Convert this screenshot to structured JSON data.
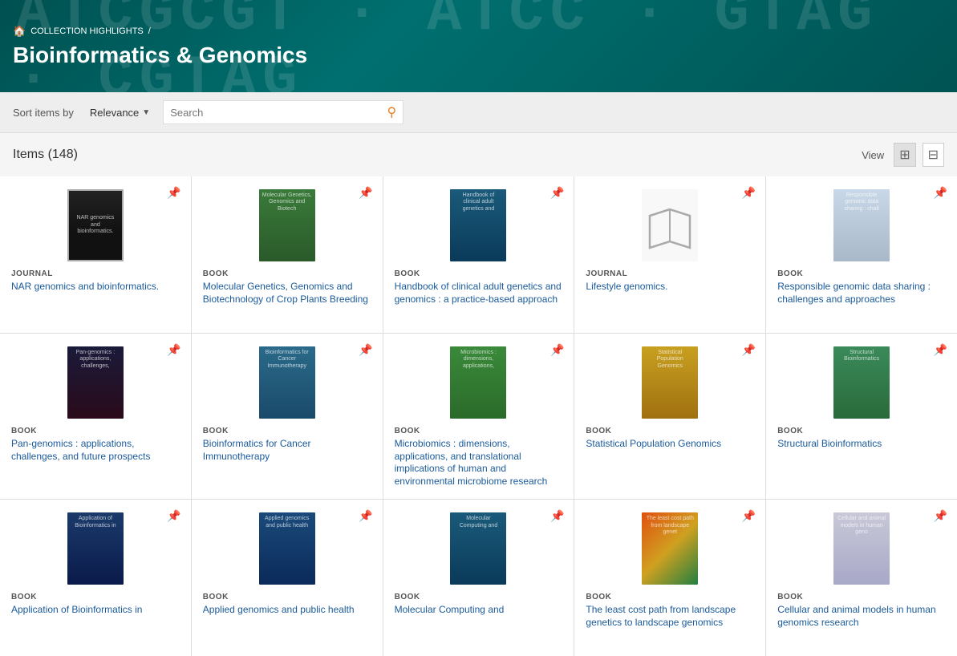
{
  "banner": {
    "breadcrumb_home": "🏠",
    "breadcrumb_label": "COLLECTION HIGHLIGHTS",
    "breadcrumb_sep": "/",
    "title": "Bioinformatics & Genomics",
    "bg_text": "ATCGCGT ATCCGTAG"
  },
  "toolbar": {
    "sort_label": "Sort items by",
    "sort_value": "Relevance",
    "search_placeholder": "Search",
    "search_icon": "🔍"
  },
  "items": {
    "count_label": "Items (148)",
    "view_label": "View"
  },
  "grid": [
    {
      "type": "JOURNAL",
      "title": "NAR genomics and bioinformatics.",
      "cover_class": "cover-nar"
    },
    {
      "type": "BOOK",
      "title": "Molecular Genetics, Genomics and Biotechnology of Crop Plants Breeding",
      "cover_class": "cover-molgen"
    },
    {
      "type": "BOOK",
      "title": "Handbook of clinical adult genetics and genomics : a practice-based approach",
      "cover_class": "cover-handbook"
    },
    {
      "type": "JOURNAL",
      "title": "Lifestyle genomics.",
      "cover_class": "cover-lifestyle",
      "is_journal_icon": true
    },
    {
      "type": "BOOK",
      "title": "Responsible genomic data sharing : challenges and approaches",
      "cover_class": "cover-responsible"
    },
    {
      "type": "BOOK",
      "title": "Pan-genomics : applications, challenges, and future prospects",
      "cover_class": "cover-pangenomics"
    },
    {
      "type": "BOOK",
      "title": "Bioinformatics for Cancer Immunotherapy",
      "cover_class": "cover-biocancer"
    },
    {
      "type": "BOOK",
      "title": "Microbiomics : dimensions, applications, and translational implications of human and environmental microbiome research",
      "cover_class": "cover-microbiomics"
    },
    {
      "type": "BOOK",
      "title": "Statistical Population Genomics",
      "cover_class": "cover-statpop"
    },
    {
      "type": "BOOK",
      "title": "Structural Bioinformatics",
      "cover_class": "cover-structural"
    },
    {
      "type": "BOOK",
      "title": "Application of Bioinformatics in",
      "cover_class": "cover-appbioinfo"
    },
    {
      "type": "BOOK",
      "title": "Applied genomics and public health",
      "cover_class": "cover-appliedgenomics"
    },
    {
      "type": "BOOK",
      "title": "Molecular Computing and",
      "cover_class": "cover-molcomp"
    },
    {
      "type": "BOOK",
      "title": "The least cost path from landscape genetics to landscape genomics",
      "cover_class": "cover-leastcost"
    },
    {
      "type": "BOOK",
      "title": "Cellular and animal models in human genomics research",
      "cover_class": "cover-cellular"
    }
  ]
}
